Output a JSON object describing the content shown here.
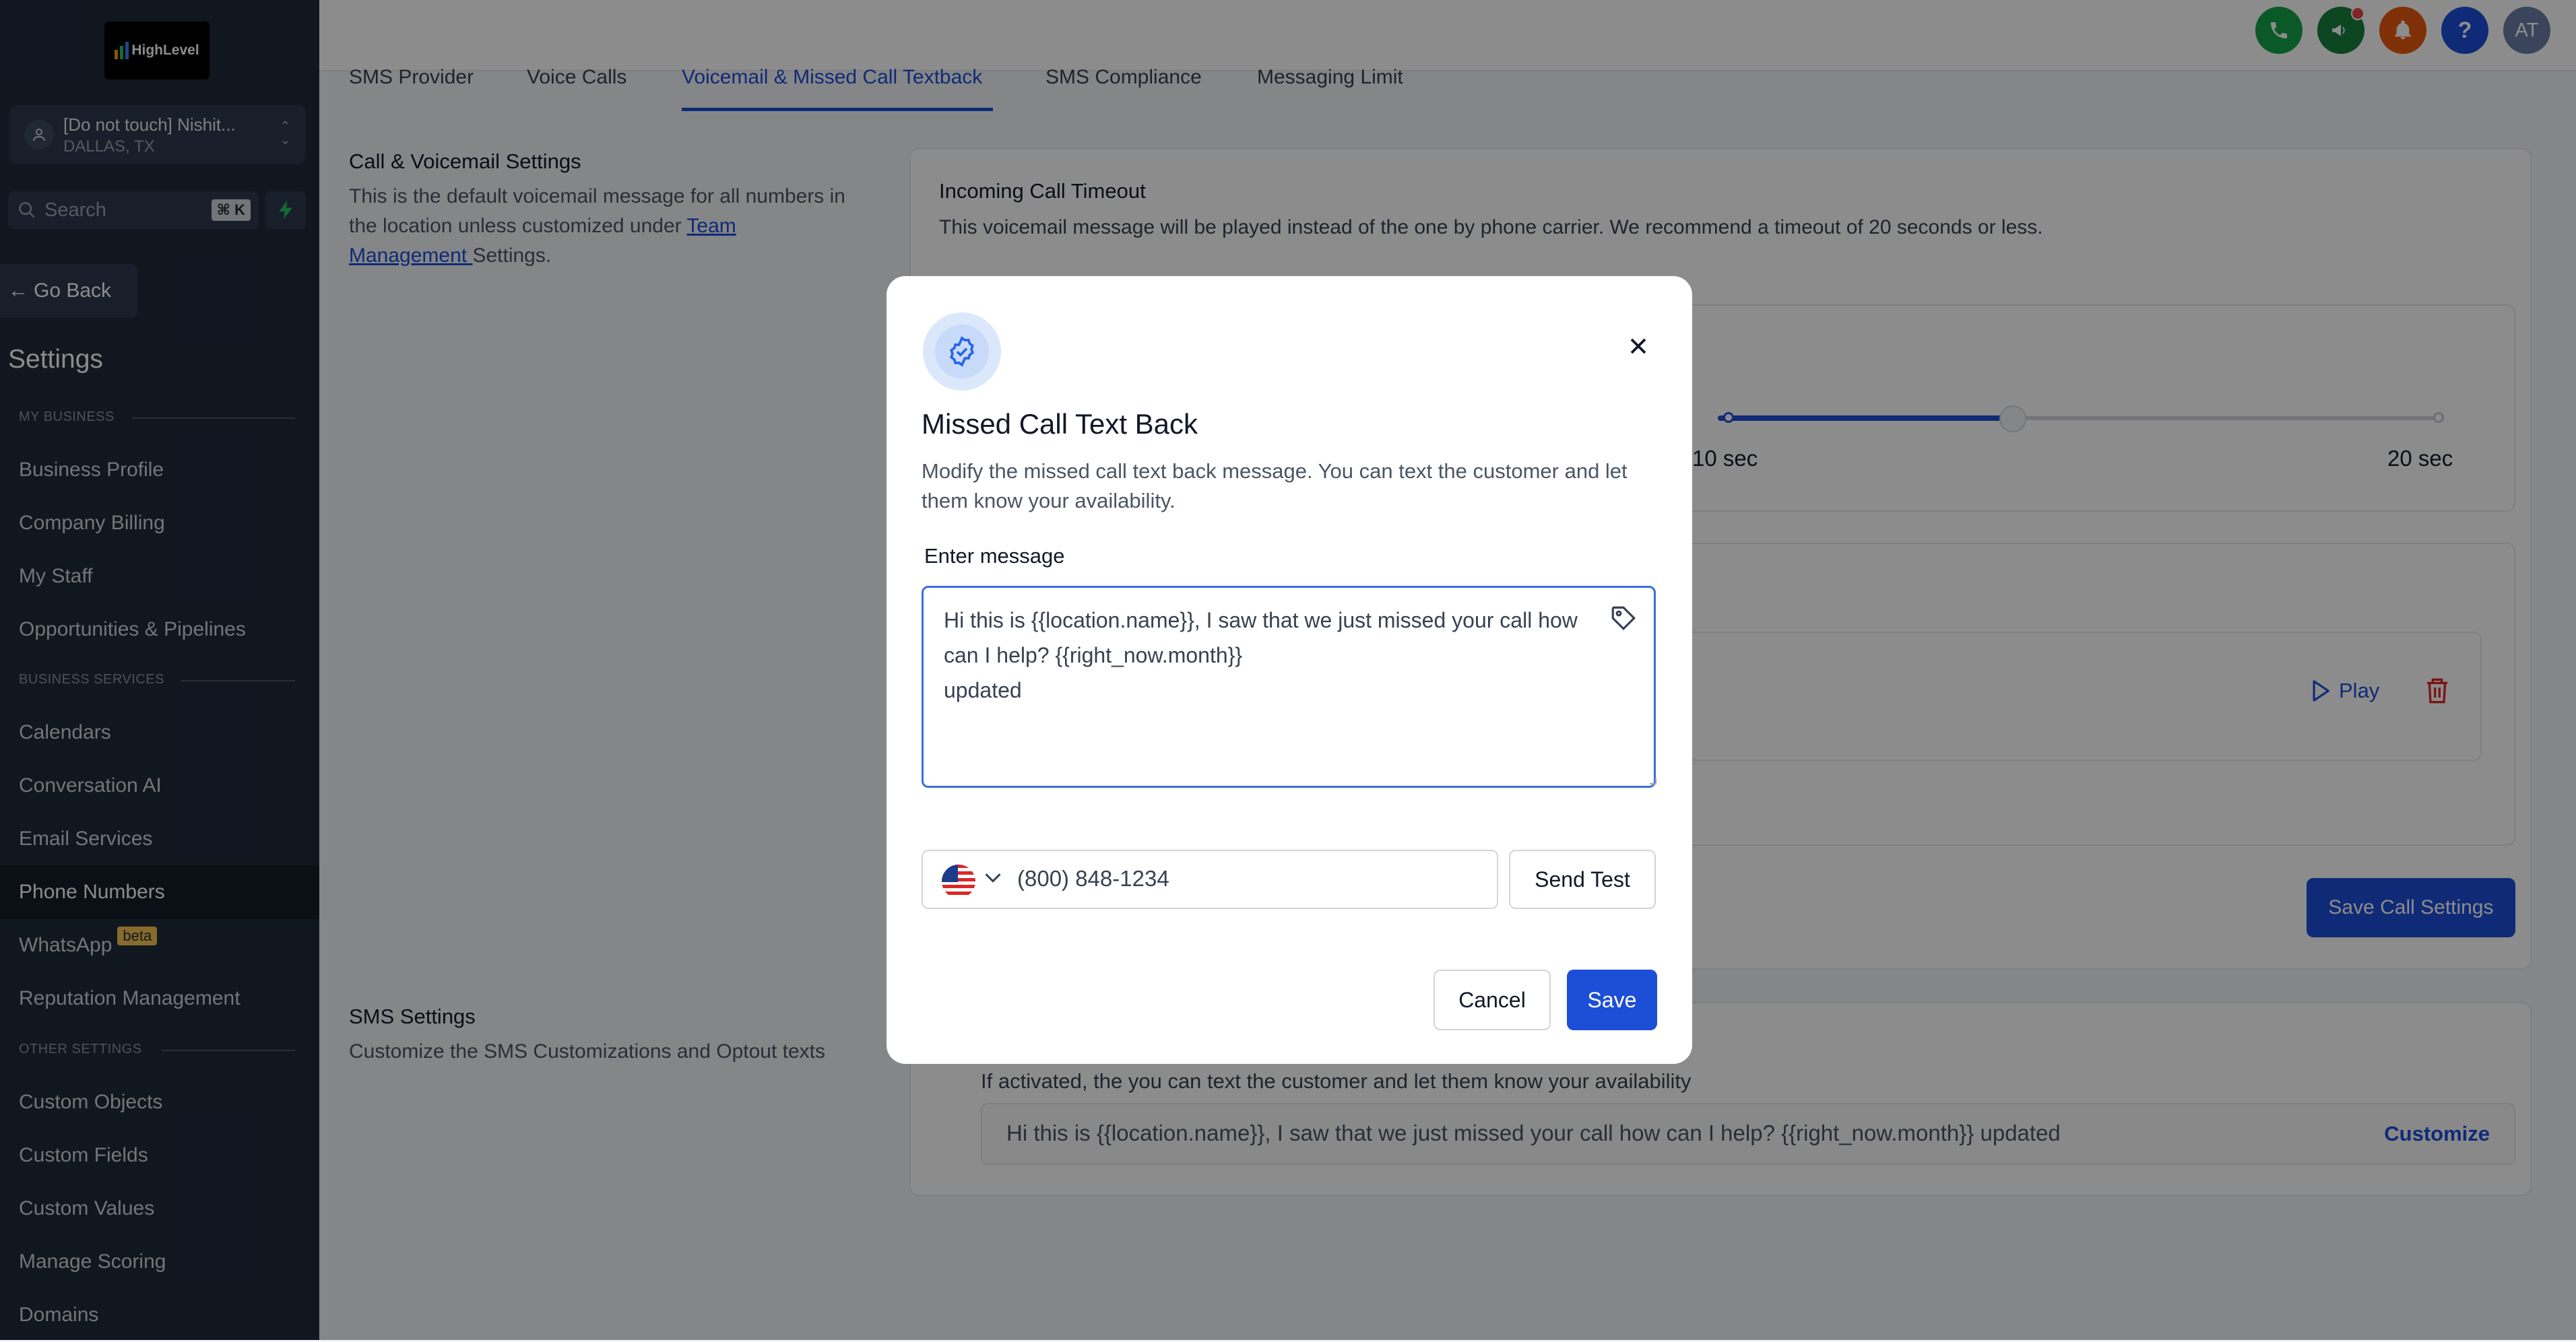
{
  "sidebar": {
    "logo_text": "HighLevel",
    "location": {
      "name": "[Do not touch] Nishit...",
      "city": "DALLAS, TX"
    },
    "search": {
      "placeholder": "Search",
      "shortcut": "⌘ K"
    },
    "go_back": "Go Back",
    "title": "Settings",
    "sections": [
      {
        "label": "MY BUSINESS",
        "items": [
          "Business Profile",
          "Company Billing",
          "My Staff",
          "Opportunities & Pipelines"
        ]
      },
      {
        "label": "BUSINESS SERVICES",
        "items": [
          "Calendars",
          "Conversation AI",
          "Email Services",
          "Phone Numbers",
          "WhatsApp",
          "Reputation Management"
        ]
      },
      {
        "label": "OTHER SETTINGS",
        "items": [
          "Custom Objects",
          "Custom Fields",
          "Custom Values",
          "Manage Scoring",
          "Domains"
        ]
      }
    ],
    "active_item": "Phone Numbers",
    "whatsapp_badge": "beta"
  },
  "topbar": {
    "avatar_initials": "AT",
    "help_label": "?"
  },
  "tabs": [
    {
      "label": "SMS Provider",
      "active": false
    },
    {
      "label": "Voice Calls",
      "active": false
    },
    {
      "label": "Voicemail & Missed Call Textback",
      "active": true
    },
    {
      "label": "SMS Compliance",
      "active": false
    },
    {
      "label": "Messaging Limit",
      "active": false
    }
  ],
  "call_voicemail": {
    "title": "Call & Voicemail Settings",
    "description_before_link": "This is the default voicemail message for all numbers in the location unless customized under ",
    "link_text": "Team Management ",
    "description_after_link": "Settings.",
    "timeout_title": "Incoming Call Timeout",
    "timeout_desc": "This voicemail message will be played instead of the one by phone carrier. We recommend a timeout of 20 seconds or less.",
    "slider_value_seconds": 14,
    "slider_max_seconds": 20,
    "slider_labels": [
      "10 sec",
      "20 sec"
    ],
    "play_label": "Play",
    "save_button": "Save Call Settings"
  },
  "sms_settings": {
    "title": "SMS Settings",
    "description": "Customize the SMS Customizations and Optout texts",
    "textback_desc": "If activated, the you can text the customer and let them know your availability",
    "textback_message": "Hi this is {{location.name}}, I saw that we just missed your call how can I help? {{right_now.month}} updated",
    "customize_label": "Customize"
  },
  "modal": {
    "title": "Missed Call Text Back",
    "description": "Modify the missed call text back message. You can text the customer and let them know your availability.",
    "message_label": "Enter message",
    "message_value": "Hi this is {{location.name}}, I saw that we just missed your call how can I help? {{right_now.month}}\nupdated",
    "phone_value": "(800) 848-1234",
    "send_test": "Send Test",
    "cancel": "Cancel",
    "save": "Save"
  },
  "colors": {
    "primary": "#1d4ed8",
    "sidebar_bg": "#1f2a3a",
    "phone_btn": "#16a34a",
    "megaphone_btn": "#15803d",
    "bell_btn": "#ea580c",
    "help_btn": "#1d4ed8",
    "avatar_btn": "#6b7fa8",
    "danger": "#dc2626"
  },
  "icons": [
    "search-icon",
    "bolt-icon",
    "arrow-left-icon",
    "phone-icon",
    "megaphone-icon",
    "bell-icon",
    "shield-check-icon",
    "close-icon",
    "tag-icon",
    "chevron-down-icon",
    "play-icon",
    "trash-icon",
    "us-flag-icon",
    "user-location-icon"
  ]
}
